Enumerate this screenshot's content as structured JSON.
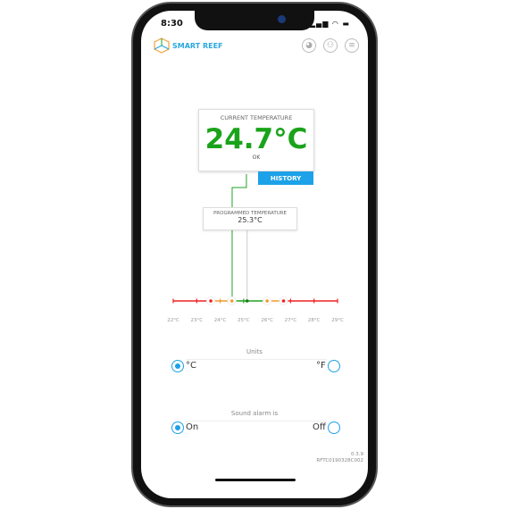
{
  "status_bar": {
    "time": "8:30",
    "icons": "signal wifi battery"
  },
  "header": {
    "brand": "SMART REEF",
    "icons": [
      "globe-icon",
      "user-icon",
      "menu-icon"
    ]
  },
  "current": {
    "label": "CURRENT TEMPERATURE",
    "value": "24.7°C",
    "status": "OK",
    "history_label": "HISTORY",
    "color": "#1aa31a"
  },
  "programmed": {
    "label": "PROGRAMMED TEMPERATURE",
    "value": "25.3°C"
  },
  "scale": {
    "min": 22,
    "max": 29,
    "ticks": [
      "22°C",
      "23°C",
      "24°C",
      "25°C",
      "26°C",
      "27°C",
      "28°C",
      "29°C"
    ],
    "alarm_low": 23.6,
    "warn_low": 24.5,
    "warn_high": 26.0,
    "alarm_high": 26.7,
    "current": 24.7,
    "programmed": 25.3,
    "colors": {
      "alarm": "#ee2222",
      "warn": "#f39a2e",
      "ok": "#22a322"
    }
  },
  "units": {
    "title": "Units",
    "option_left": "°C",
    "option_right": "°F",
    "selected": "left"
  },
  "alarm": {
    "title": "Sound alarm is",
    "option_left": "On",
    "option_right": "Off",
    "selected": "left"
  },
  "footer": {
    "version": "0.3.9",
    "serial": "RFTC0190328C002"
  }
}
